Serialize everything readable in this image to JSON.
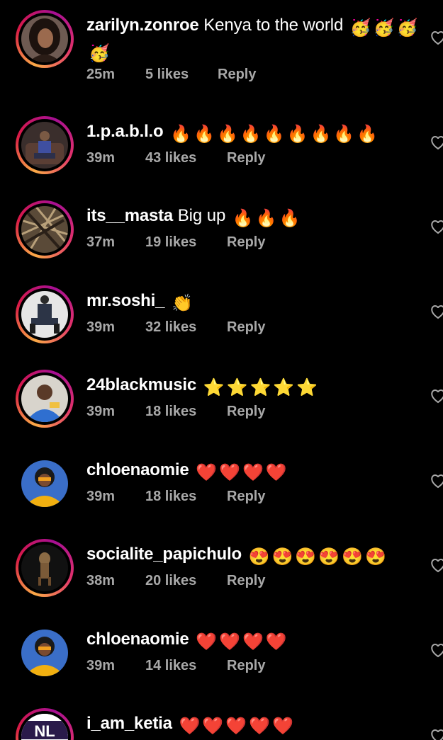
{
  "comments": [
    {
      "username": "zarilyn.zonroe",
      "text": "Kenya to the world",
      "emoji": "🥳",
      "emoji_count": 4,
      "time": "25m",
      "likes": "5 likes",
      "reply": "Reply"
    },
    {
      "username": "1.p.a.b.l.o",
      "text": "",
      "emoji": "🔥",
      "emoji_count": 9,
      "time": "39m",
      "likes": "43 likes",
      "reply": "Reply"
    },
    {
      "username": "its__masta",
      "text": "Big up",
      "emoji": "🔥",
      "emoji_count": 3,
      "time": "37m",
      "likes": "19 likes",
      "reply": "Reply"
    },
    {
      "username": "mr.soshi_",
      "text": "",
      "emoji": "👏",
      "emoji_count": 1,
      "time": "39m",
      "likes": "32 likes",
      "reply": "Reply"
    },
    {
      "username": "24blackmusic",
      "text": "",
      "emoji": "⭐",
      "emoji_count": 5,
      "time": "39m",
      "likes": "18 likes",
      "reply": "Reply"
    },
    {
      "username": "chloenaomie",
      "text": "",
      "emoji": "❤️",
      "emoji_count": 4,
      "time": "39m",
      "likes": "18 likes",
      "reply": "Reply"
    },
    {
      "username": "socialite_papichulo",
      "text": "",
      "emoji": "😍",
      "emoji_count": 6,
      "time": "38m",
      "likes": "20 likes",
      "reply": "Reply"
    },
    {
      "username": "chloenaomie",
      "text": "",
      "emoji": "❤️",
      "emoji_count": 4,
      "time": "39m",
      "likes": "14 likes",
      "reply": "Reply"
    },
    {
      "username": "i_am_ketia",
      "text": "",
      "emoji": "❤️",
      "emoji_count": 5,
      "time": "",
      "likes": "",
      "reply": ""
    }
  ],
  "avatar_logo_text": "NL",
  "colors": {
    "background": "#000000",
    "meta": "#a8a8a8",
    "heart_outline": "#a8a8a8"
  }
}
